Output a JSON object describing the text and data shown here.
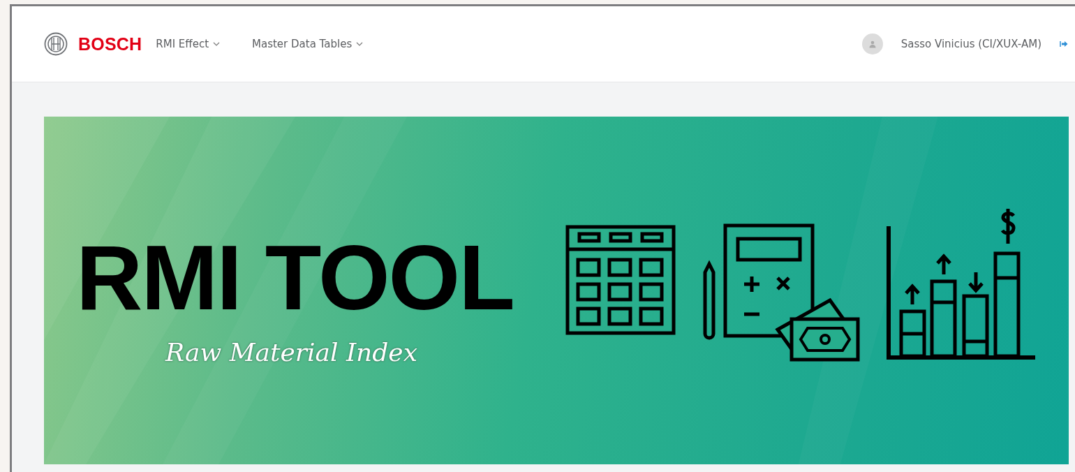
{
  "header": {
    "brand": "BOSCH",
    "menus": [
      {
        "label": "RMI Effect"
      },
      {
        "label": "Master Data Tables"
      }
    ],
    "user": {
      "name": "Sasso Vinicius (CI/XUX-AM)"
    }
  },
  "banner": {
    "title": "RMI TOOL",
    "subtitle": "Raw Material Index"
  }
}
